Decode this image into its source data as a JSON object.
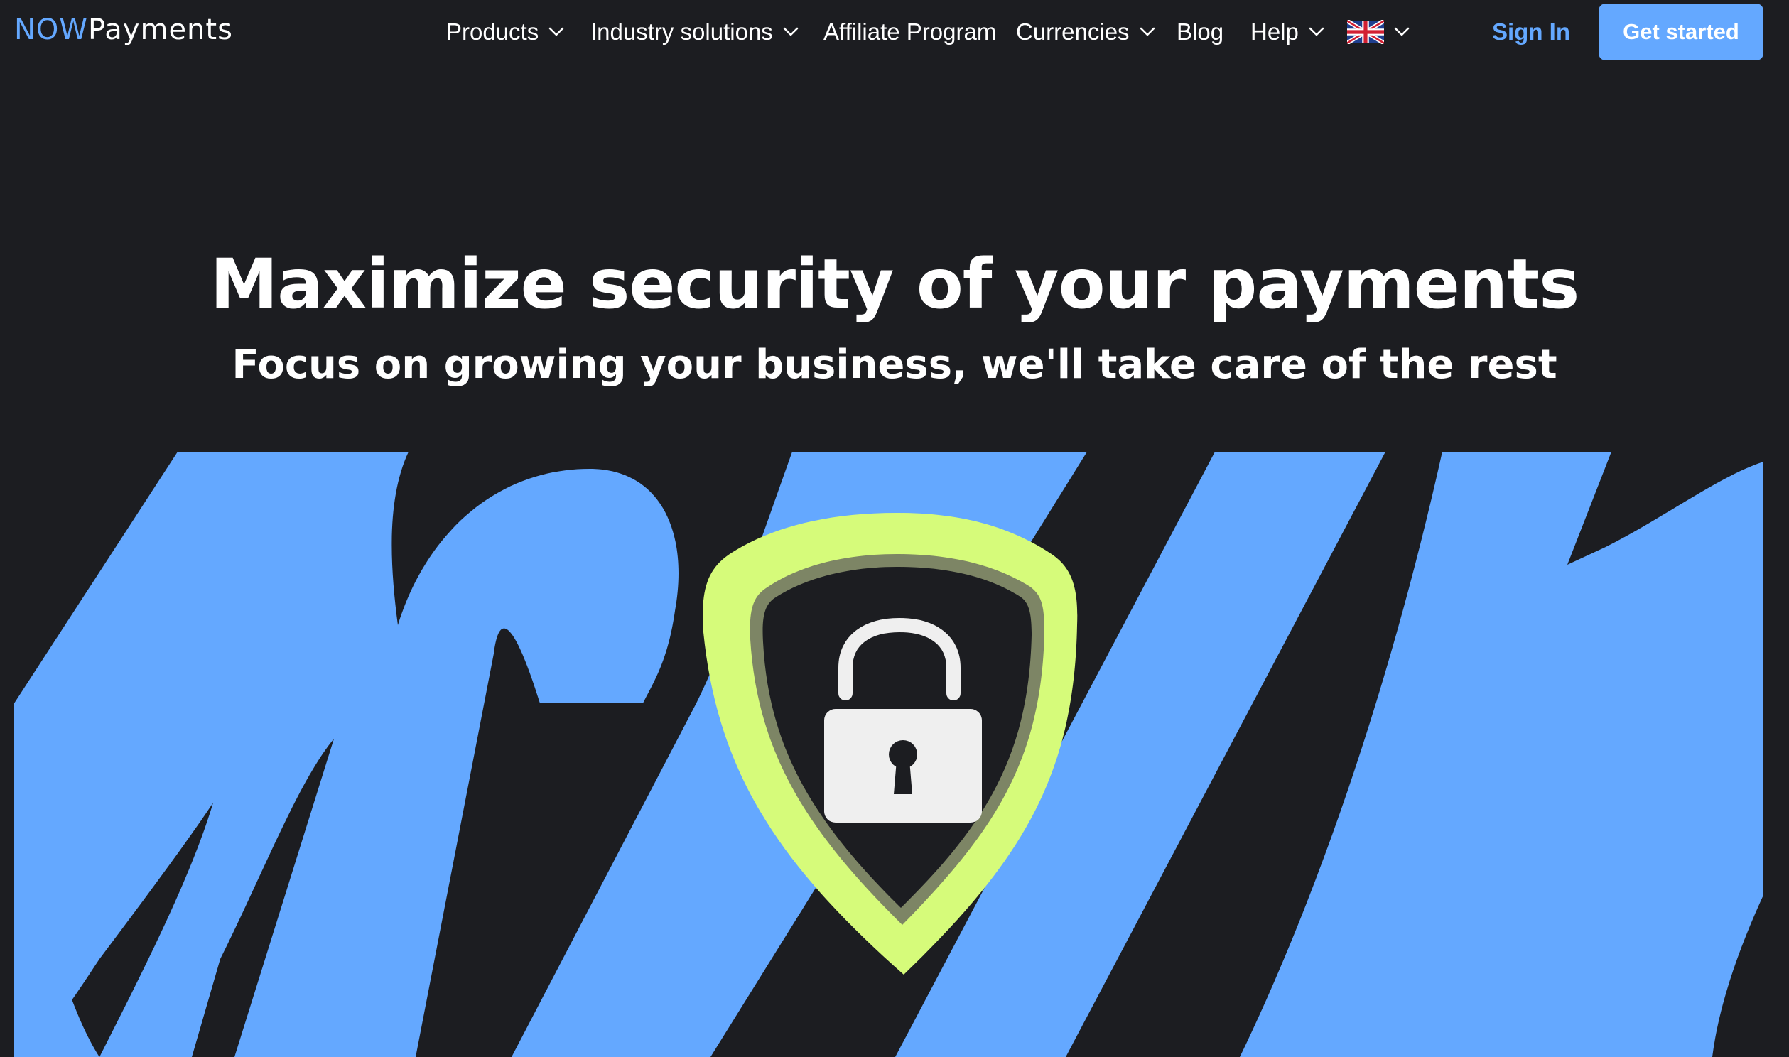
{
  "brand": {
    "name_prefix": "NOW",
    "name_suffix": "Payments",
    "accent_color": "#64a8ff",
    "background_color": "#1c1d21",
    "shield_color": "#d6fb7a"
  },
  "nav": {
    "items": [
      {
        "label": "Products",
        "has_dropdown": true
      },
      {
        "label": "Industry solutions",
        "has_dropdown": true
      },
      {
        "label": "Affiliate Program",
        "has_dropdown": false
      },
      {
        "label": "Currencies",
        "has_dropdown": true
      },
      {
        "label": "Blog",
        "has_dropdown": false
      },
      {
        "label": "Help",
        "has_dropdown": true
      }
    ],
    "language_icon": "uk-flag-icon",
    "sign_in_label": "Sign In",
    "get_started_label": "Get started"
  },
  "hero": {
    "title": "Maximize security of your payments",
    "subtitle": "Focus on growing your business, we'll take care of the rest",
    "illustration_icon": "shield-lock-icon"
  }
}
